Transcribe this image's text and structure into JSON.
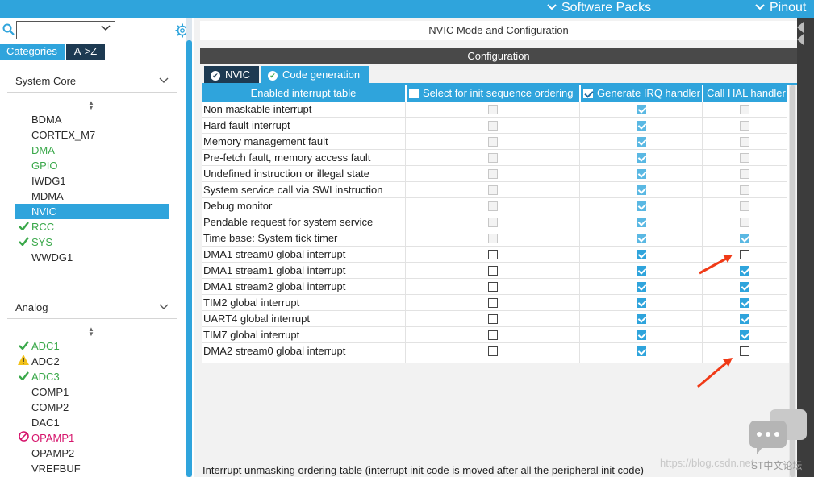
{
  "topbar": {
    "software_packs": "Software Packs",
    "pinout": "Pinout"
  },
  "left": {
    "tabs": {
      "categories": "Categories",
      "az": "A->Z"
    },
    "sections": [
      {
        "title": "System Core",
        "items": [
          {
            "label": "BDMA",
            "state": "none"
          },
          {
            "label": "CORTEX_M7",
            "state": "none"
          },
          {
            "label": "DMA",
            "state": "green"
          },
          {
            "label": "GPIO",
            "state": "green"
          },
          {
            "label": "IWDG1",
            "state": "none"
          },
          {
            "label": "MDMA",
            "state": "none"
          },
          {
            "label": "NVIC",
            "state": "selected"
          },
          {
            "label": "RCC",
            "state": "check"
          },
          {
            "label": "SYS",
            "state": "check"
          },
          {
            "label": "WWDG1",
            "state": "none"
          }
        ]
      },
      {
        "title": "Analog",
        "items": [
          {
            "label": "ADC1",
            "state": "check"
          },
          {
            "label": "ADC2",
            "state": "warning"
          },
          {
            "label": "ADC3",
            "state": "check"
          },
          {
            "label": "COMP1",
            "state": "none"
          },
          {
            "label": "COMP2",
            "state": "none"
          },
          {
            "label": "DAC1",
            "state": "none"
          },
          {
            "label": "OPAMP1",
            "state": "forbidden"
          },
          {
            "label": "OPAMP2",
            "state": "none"
          },
          {
            "label": "VREFBUF",
            "state": "none"
          }
        ]
      }
    ]
  },
  "right": {
    "header": "NVIC Mode and Configuration",
    "config_title": "Configuration",
    "tabs": {
      "nvic": "NVIC",
      "codegen": "Code generation"
    },
    "table": {
      "columns": {
        "enabled": "Enabled interrupt table",
        "select_init": "Select for init sequence ordering",
        "gen_irq": "Generate IRQ handler",
        "call_hal": "Call HAL handler"
      },
      "header_checks": {
        "select_init": false,
        "gen_irq": true
      },
      "rows": [
        {
          "name": "Non maskable interrupt",
          "select": "dis",
          "irq": "dis-chk",
          "hal": "dis"
        },
        {
          "name": "Hard fault interrupt",
          "select": "dis",
          "irq": "dis-chk",
          "hal": "dis"
        },
        {
          "name": "Memory management fault",
          "select": "dis",
          "irq": "dis-chk",
          "hal": "dis"
        },
        {
          "name": "Pre-fetch fault, memory access fault",
          "select": "dis",
          "irq": "dis-chk",
          "hal": "dis"
        },
        {
          "name": "Undefined instruction or illegal state",
          "select": "dis",
          "irq": "dis-chk",
          "hal": "dis"
        },
        {
          "name": "System service call via SWI instruction",
          "select": "dis",
          "irq": "dis-chk",
          "hal": "dis"
        },
        {
          "name": "Debug monitor",
          "select": "dis",
          "irq": "dis-chk",
          "hal": "dis"
        },
        {
          "name": "Pendable request for system service",
          "select": "dis",
          "irq": "dis-chk",
          "hal": "dis"
        },
        {
          "name": "Time base: System tick timer",
          "select": "dis",
          "irq": "dis-chk",
          "hal": "dis-chk"
        },
        {
          "name": "DMA1 stream0 global interrupt",
          "select": "un",
          "irq": "chk",
          "hal": "un"
        },
        {
          "name": "DMA1 stream1 global interrupt",
          "select": "un",
          "irq": "chk",
          "hal": "chk"
        },
        {
          "name": "DMA1 stream2 global interrupt",
          "select": "un",
          "irq": "chk",
          "hal": "chk"
        },
        {
          "name": "TIM2 global interrupt",
          "select": "un",
          "irq": "chk",
          "hal": "chk"
        },
        {
          "name": "UART4 global interrupt",
          "select": "un",
          "irq": "chk",
          "hal": "chk"
        },
        {
          "name": "TIM7 global interrupt",
          "select": "un",
          "irq": "chk",
          "hal": "chk"
        },
        {
          "name": "DMA2 stream0 global interrupt",
          "select": "un",
          "irq": "chk",
          "hal": "un"
        }
      ]
    },
    "bottom_text": "Interrupt unmasking ordering table (interrupt init code is moved after all the peripheral init code)"
  },
  "watermark": {
    "url": "https://blog.csdn.net",
    "label": "ST中文论坛"
  },
  "colors": {
    "accent": "#2fa4dc",
    "dark_tab": "#1d3a52",
    "green": "#3aa84a",
    "pink": "#d6156c",
    "annotation": "#f03a17"
  }
}
